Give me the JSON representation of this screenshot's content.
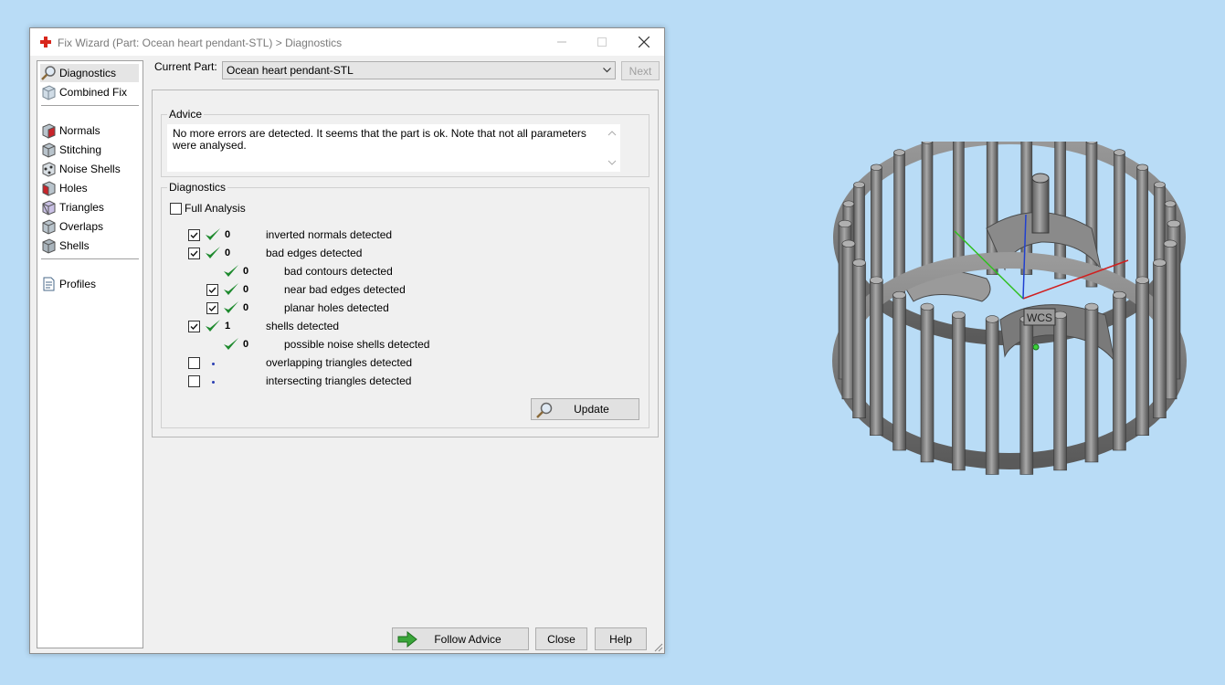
{
  "window": {
    "title": "Fix Wizard (Part: Ocean heart pendant-STL) > Diagnostics",
    "minimize_icon": "minimize-icon",
    "maximize_icon": "maximize-icon",
    "close_icon": "close-icon"
  },
  "sidebar": {
    "items_top": [
      {
        "label": "Diagnostics",
        "icon": "magnifier-icon",
        "selected": true
      },
      {
        "label": "Combined Fix",
        "icon": "cube-icon"
      }
    ],
    "items_mid": [
      {
        "label": "Normals",
        "icon": "normals-cube-icon"
      },
      {
        "label": "Stitching",
        "icon": "stitching-cube-icon"
      },
      {
        "label": "Noise Shells",
        "icon": "noise-shells-icon"
      },
      {
        "label": "Holes",
        "icon": "holes-cube-icon"
      },
      {
        "label": "Triangles",
        "icon": "triangles-cube-icon"
      },
      {
        "label": "Overlaps",
        "icon": "overlaps-cube-icon"
      },
      {
        "label": "Shells",
        "icon": "shells-cube-icon"
      }
    ],
    "items_bottom": [
      {
        "label": "Profiles",
        "icon": "document-icon"
      }
    ]
  },
  "current_part": {
    "label": "Current Part:",
    "value": "Ocean heart pendant-STL",
    "next_label": "Next"
  },
  "advice": {
    "title": "Advice",
    "text": "No more errors are detected. It seems that the part is ok. Note that not all parameters were analysed."
  },
  "diagnostics": {
    "title": "Diagnostics",
    "full_analysis_label": "Full Analysis",
    "full_analysis_checked": false,
    "rows": [
      {
        "checkbox": true,
        "checked": true,
        "status": "ok",
        "count": "0",
        "label": "inverted normals detected",
        "indent": 0
      },
      {
        "checkbox": true,
        "checked": true,
        "status": "ok",
        "count": "0",
        "label": "bad edges detected",
        "indent": 0
      },
      {
        "checkbox": false,
        "checked": false,
        "status": "ok",
        "count": "0",
        "label": "bad contours detected",
        "indent": 1
      },
      {
        "checkbox": true,
        "checked": true,
        "status": "ok",
        "count": "0",
        "label": "near bad edges detected",
        "indent": 1
      },
      {
        "checkbox": true,
        "checked": true,
        "status": "ok",
        "count": "0",
        "label": "planar holes detected",
        "indent": 1
      },
      {
        "checkbox": true,
        "checked": true,
        "status": "ok",
        "count": "1",
        "label": "shells detected",
        "indent": 0
      },
      {
        "checkbox": false,
        "checked": false,
        "status": "ok",
        "count": "0",
        "label": "possible noise shells detected",
        "indent": 1
      },
      {
        "checkbox": true,
        "checked": false,
        "status": "none",
        "count": "",
        "label": "overlapping triangles detected",
        "indent": 0
      },
      {
        "checkbox": true,
        "checked": false,
        "status": "none",
        "count": "",
        "label": "intersecting triangles detected",
        "indent": 0
      }
    ],
    "update_label": "Update"
  },
  "footer": {
    "follow_advice_label": "Follow Advice",
    "close_label": "Close",
    "help_label": "Help"
  },
  "viewport": {
    "wcs_label": "WCS",
    "background": "#b9dcf6",
    "axis_colors": {
      "x": "#d02020",
      "y": "#30c020",
      "z": "#2040d0"
    }
  },
  "colors": {
    "check_green": "#1e8a2e",
    "title_icon_red": "#d8261c"
  }
}
